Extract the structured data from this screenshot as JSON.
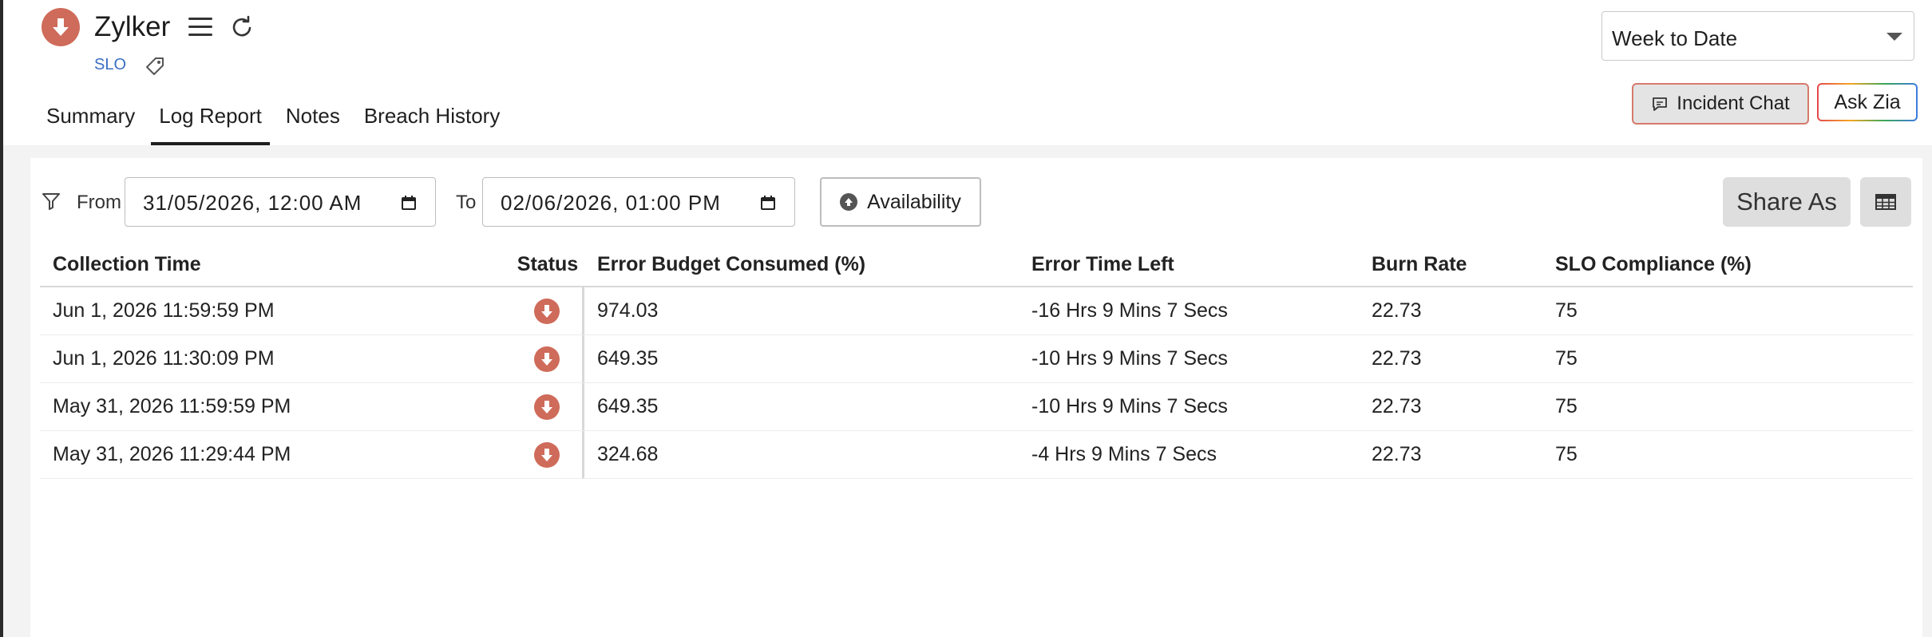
{
  "header": {
    "title": "Zylker",
    "type_tag": "SLO",
    "status_icon": "down-arrow-icon",
    "status_color": "#cf6b5a",
    "tabs": [
      {
        "label": "Summary",
        "active": false
      },
      {
        "label": "Log Report",
        "active": true
      },
      {
        "label": "Notes",
        "active": false
      },
      {
        "label": "Breach History",
        "active": false
      }
    ],
    "range_select": "Week to Date",
    "incident_chat": "Incident Chat",
    "ask_zia": "Ask Zia"
  },
  "filters": {
    "from_label": "From",
    "from_value": "31/05/2026, 12:00 AM",
    "to_label": "To",
    "to_value": "02/06/2026, 01:00 PM",
    "availability": "Availability",
    "share_as": "Share As"
  },
  "table": {
    "columns": [
      "Collection Time",
      "Status",
      "Error Budget Consumed (%)",
      "Error Time Left",
      "Burn Rate",
      "SLO Compliance (%)"
    ],
    "rows": [
      {
        "time": "Jun 1, 2026 11:59:59 PM",
        "status": "down",
        "consumed": "974.03",
        "left": "-16 Hrs 9 Mins 7 Secs",
        "burn": "22.73",
        "compliance": "75"
      },
      {
        "time": "Jun 1, 2026 11:30:09 PM",
        "status": "down",
        "consumed": "649.35",
        "left": "-10 Hrs 9 Mins 7 Secs",
        "burn": "22.73",
        "compliance": "75"
      },
      {
        "time": "May 31, 2026 11:59:59 PM",
        "status": "down",
        "consumed": "649.35",
        "left": "-10 Hrs 9 Mins 7 Secs",
        "burn": "22.73",
        "compliance": "75"
      },
      {
        "time": "May 31, 2026 11:29:44 PM",
        "status": "down",
        "consumed": "324.68",
        "left": "-4 Hrs 9 Mins 7 Secs",
        "burn": "22.73",
        "compliance": "75"
      }
    ]
  }
}
